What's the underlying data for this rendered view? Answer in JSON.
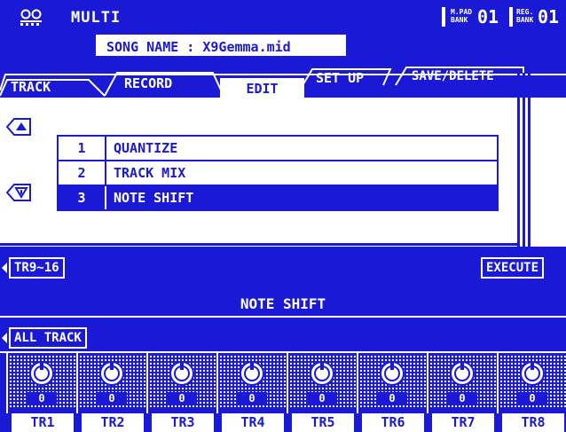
{
  "header": {
    "mode": "MULTI",
    "mpad_bank_top": "M.PAD",
    "mpad_bank_bottom": "BANK",
    "mpad_bank_value": "01",
    "reg_bank_top": "REG.",
    "reg_bank_bottom": "BANK",
    "reg_bank_value": "01",
    "song_name": "SONG NAME : X9Gemma.mid"
  },
  "tabs": [
    {
      "label": "TRACK"
    },
    {
      "label": "RECORD"
    },
    {
      "label": "EDIT",
      "active": true
    },
    {
      "label": "SET UP"
    },
    {
      "label": "SAVE/DELETE"
    }
  ],
  "list": [
    {
      "num": "1",
      "label": "QUANTIZE"
    },
    {
      "num": "2",
      "label": "TRACK MIX"
    },
    {
      "num": "3",
      "label": "NOTE SHIFT",
      "selected": true
    }
  ],
  "buttons": {
    "tr_range": "TR9~16",
    "execute": "EXECUTE",
    "all_track": "ALL TRACK"
  },
  "section_title": "NOTE SHIFT",
  "tracks": [
    {
      "label": "TR1",
      "value": "0"
    },
    {
      "label": "TR2",
      "value": "0"
    },
    {
      "label": "TR3",
      "value": "0"
    },
    {
      "label": "TR4",
      "value": "0"
    },
    {
      "label": "TR5",
      "value": "0"
    },
    {
      "label": "TR6",
      "value": "0"
    },
    {
      "label": "TR7",
      "value": "0"
    },
    {
      "label": "TR8",
      "value": "0"
    }
  ],
  "colors": {
    "accent": "#1a1ad6",
    "bg": "#ffffff"
  }
}
